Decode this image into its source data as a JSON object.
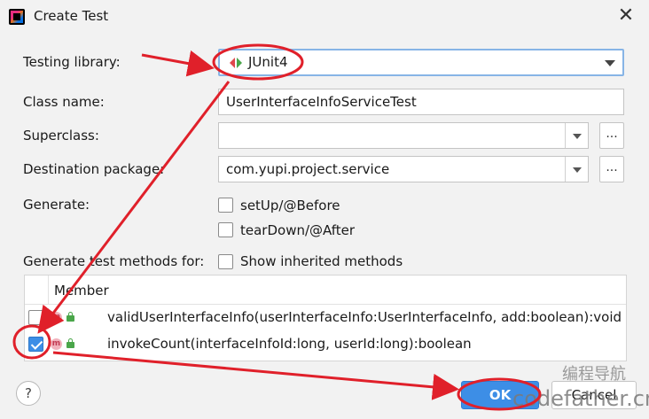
{
  "window": {
    "title": "Create Test"
  },
  "form": {
    "testing_library": {
      "label": "Testing library:",
      "value": "JUnit4"
    },
    "class_name": {
      "label": "Class name:",
      "value": "UserInterfaceInfoServiceTest"
    },
    "superclass": {
      "label": "Superclass:",
      "value": "",
      "browse": "..."
    },
    "destination_package": {
      "label": "Destination package:",
      "value": "com.yupi.project.service",
      "browse": "..."
    },
    "generate": {
      "label": "Generate:",
      "options": [
        {
          "label": "setUp/@Before",
          "checked": false
        },
        {
          "label": "tearDown/@After",
          "checked": false
        }
      ]
    },
    "generate_methods": {
      "label": "Generate test methods for:",
      "show_inherited": {
        "label": "Show inherited methods",
        "checked": false
      }
    }
  },
  "members": {
    "header": "Member",
    "rows": [
      {
        "signature": "validUserInterfaceInfo(userInterfaceInfo:UserInterfaceInfo, add:boolean):void",
        "checked": false,
        "icon": "m"
      },
      {
        "signature": "invokeCount(interfaceInfoId:long, userId:long):boolean",
        "checked": true,
        "icon": "m"
      }
    ]
  },
  "buttons": {
    "ok": "OK",
    "cancel": "Cancel",
    "help": "?"
  },
  "watermark": {
    "line1": "编程导航",
    "line2": "codefather.cn"
  },
  "colors": {
    "accent": "#3d8ee6",
    "annotation_red": "#e0202a",
    "junit_green": "#4aa64a",
    "junit_red": "#e0474c"
  },
  "icons": [
    "intellij-logo-icon",
    "close-icon",
    "junit-icon",
    "chevron-down-icon",
    "method-icon",
    "lock-icon",
    "help-icon"
  ]
}
